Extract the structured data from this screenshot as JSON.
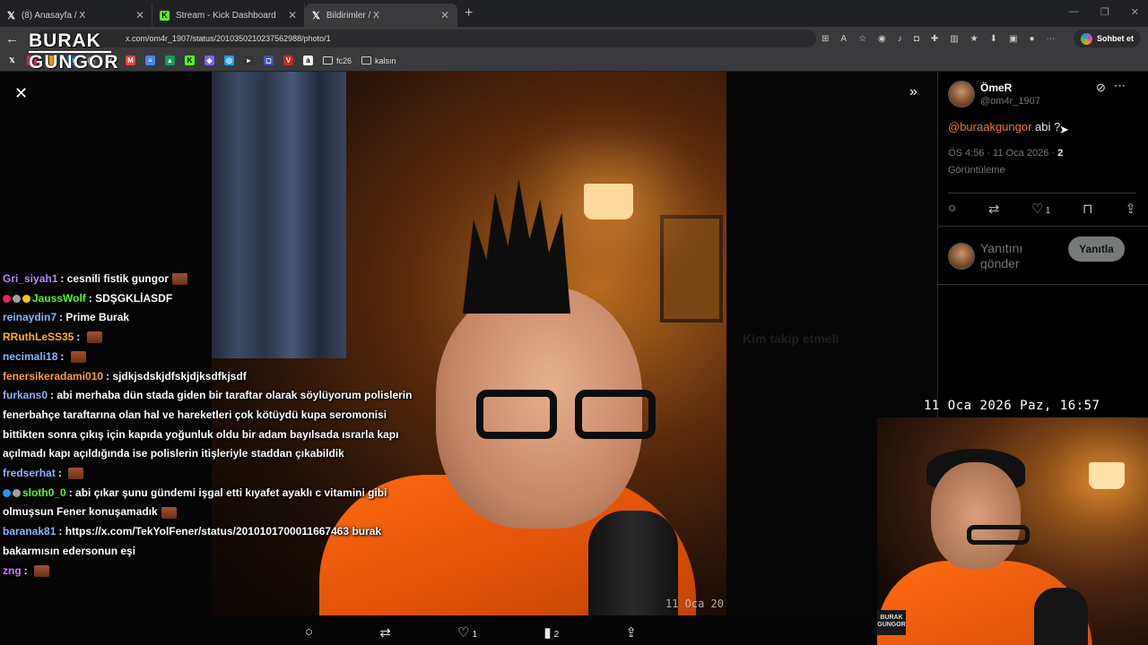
{
  "tabs": [
    {
      "icon": "x-icon",
      "title": "(8) Anasayfa / X",
      "active": false
    },
    {
      "icon": "kick-icon",
      "title": "Stream - Kick Dashboard",
      "active": false
    },
    {
      "icon": "x-icon",
      "title": "Bildirimler / X",
      "active": true
    }
  ],
  "address": {
    "url": "x.com/om4r_1907/status/2010350210237562988/photo/1"
  },
  "chat_button": {
    "label": "Sohbet et"
  },
  "bookmarks": {
    "folders": [
      "fc26",
      "kalsın"
    ]
  },
  "logo": {
    "line1": "BURAK",
    "line2": "GUNGOR"
  },
  "tweet": {
    "author_name": "ÖmeR",
    "author_handle": "@om4r_1907",
    "mention": "@buraakgungor",
    "text": " abi ?",
    "time": "ÖS 4:56 · 11 Oca 2026 · ",
    "views_count": "2",
    "views_label": "Görüntüleme",
    "like_count": "1"
  },
  "reply": {
    "placeholder": "Yanıtını gönder",
    "button": "Yanıtla"
  },
  "background_sidebar": [
    "Kim takip etmeli"
  ],
  "clock": "11 Oca 2026 Paz, 16:57",
  "photo_stamp": "11 Oca 20",
  "webcam_tag": "BURAK GUNGOR",
  "photo_actions": {
    "like_count": "1",
    "views_count": "2"
  },
  "chat": [
    {
      "user": "Gri_siyah1",
      "color": "#b48cff",
      "text": "cesnili fistik gungor",
      "emote": true
    },
    {
      "user": "JaussWolf",
      "color": "#53fc18",
      "text": "SDŞGKLİASDF",
      "badges": [
        "#e91e63",
        "#9e9e9e",
        "#ffc107"
      ]
    },
    {
      "user": "reinaydin7",
      "color": "#8ab4f8",
      "text": "Prime Burak"
    },
    {
      "user": "RRuthLeSS35",
      "color": "#ffb020",
      "text": "",
      "emote": true
    },
    {
      "user": "necimali18",
      "color": "#8ab4f8",
      "text": "",
      "emote": true
    },
    {
      "user": "fenersikeradami010",
      "color": "#ff9d3a",
      "text": "sjdkjsdskjdfskjdjksdfkjsdf"
    },
    {
      "user": "furkans0",
      "color": "#8ab4f8",
      "text": "abi merhaba dün stada giden bir taraftar olarak söylüyorum polislerin fenerbahçe taraftarına olan hal ve hareketleri çok kötüydü kupa seromonisi bittikten sonra çıkış için kapıda yoğunluk oldu bir adam bayılsada ısrarla kapı açılmadı kapı açıldığında ise polislerin itişleriyle staddan çıkabildik"
    },
    {
      "user": "fredserhat",
      "color": "#8ab4f8",
      "text": "",
      "emote": true
    },
    {
      "user": "sloth0_0",
      "color": "#53fc18",
      "text": "abi çıkar şunu gündemi işgal etti kıyafet ayaklı c vitamini gibi olmuşsun Fener konuşamadık",
      "emote": true,
      "badges": [
        "#2196f3",
        "#9e9e9e"
      ]
    },
    {
      "user": "baranak81",
      "color": "#8ab4f8",
      "text": "https://x.com/TekYolFener/status/2010101700011667463 burak bakarmısın edersonun eşi"
    },
    {
      "user": "zng",
      "color": "#d07aff",
      "text": "",
      "emote": true
    }
  ],
  "colors": {
    "kick": "#53fc18",
    "mention": "#f07a2a",
    "x_bg": "#000000"
  }
}
